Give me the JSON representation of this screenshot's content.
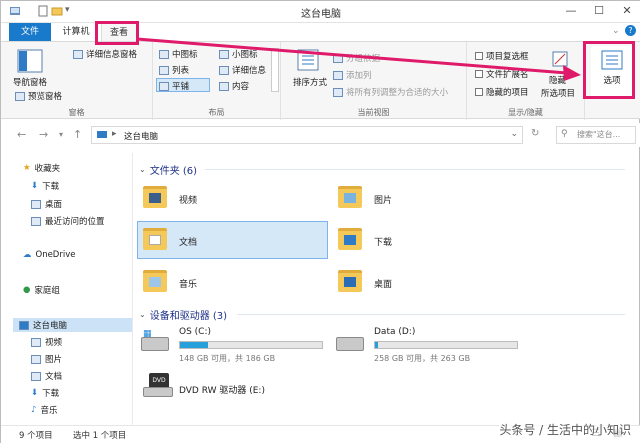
{
  "window": {
    "title": "这台电脑"
  },
  "tabs": {
    "file": "文件",
    "computer": "计算机",
    "view": "查看"
  },
  "ribbon": {
    "pane": {
      "nav_pane": "导航窗格",
      "preview_pane": "预览窗格",
      "details_pane": "详细信息窗格",
      "label": "窗格"
    },
    "layout": {
      "medium_icons": "中图标",
      "small_icons": "小图标",
      "list": "列表",
      "details": "详细信息",
      "tiles": "平铺",
      "content": "内容",
      "label": "布局"
    },
    "current_view": {
      "sort_by": "排序方式",
      "group_by": "分组依据",
      "add_columns": "添加列",
      "size_all_columns": "将所有列调整为合适的大小",
      "label": "当前视图"
    },
    "show_hide": {
      "item_checkboxes": "项目复选框",
      "file_extensions": "文件扩展名",
      "hidden_items": "隐藏的项目",
      "hide_selected": "隐藏",
      "hide_selected_2": "所选项目",
      "label": "显示/隐藏"
    },
    "options": "选项"
  },
  "address": {
    "path": "这台电脑",
    "search_placeholder": "搜索\"这台..."
  },
  "navpane": {
    "favorites": "收藏夹",
    "fav_items": [
      "下载",
      "桌面",
      "最近访问的位置"
    ],
    "onedrive": "OneDrive",
    "homegroup": "家庭组",
    "this_pc": "这台电脑",
    "pc_items": [
      "视频",
      "图片",
      "文档",
      "下载",
      "音乐"
    ]
  },
  "folders": {
    "header": "文件夹 (6)",
    "items": [
      "视频",
      "图片",
      "文档",
      "下载",
      "音乐",
      "桌面"
    ]
  },
  "drives": {
    "header": "设备和驱动器 (3)",
    "os_name": "OS (C:)",
    "os_free": "148 GB 可用，共 186 GB",
    "os_used_fraction": 0.2,
    "data_name": "Data (D:)",
    "data_free": "258 GB 可用，共 263 GB",
    "data_used_fraction": 0.02,
    "dvd_name": "DVD RW 驱动器 (E:)"
  },
  "status": {
    "count": "9 个项目",
    "selected": "选中 1 个项目"
  },
  "watermark": "头条号 / 生活中的小知识",
  "colors": {
    "accent": "#1979ca",
    "highlight": "#e01a6a",
    "folder": "#f4c95a",
    "drive_bar": "#26a0da"
  }
}
